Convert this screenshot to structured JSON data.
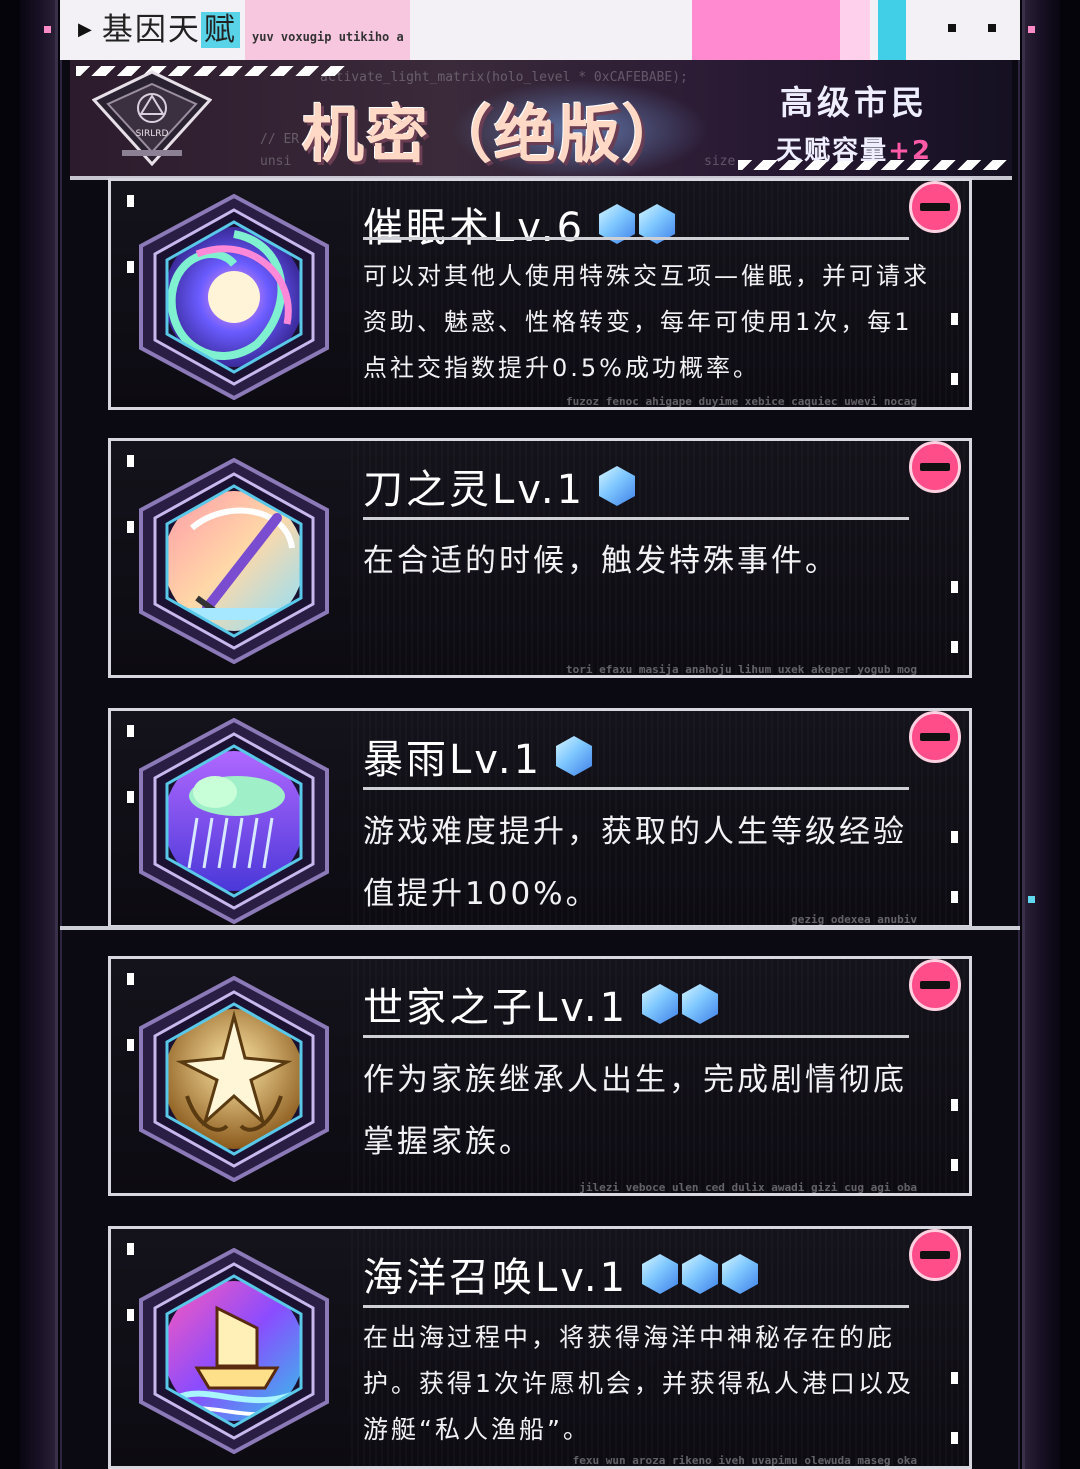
{
  "tab": {
    "title": "基因天赋",
    "subtitle": "yuv voxugip utikiho a"
  },
  "banner": {
    "badge_text": "SIRLRD",
    "title": "机密（绝版）",
    "rank_title": "高级市民",
    "rank_capacity_label": "天赋容量",
    "rank_capacity_bonus": "+2",
    "code_line_1": "activate_light_matrix(holo_level * 0xCAFEBABE);",
    "code_line_2": "// ER",
    "code_line_3": "unsi",
    "code_line_4": "size"
  },
  "colors": {
    "accent_pink": "#ff4d8a",
    "gem_blue": "#7fc8ff",
    "title_peach": "#ffd9c6"
  },
  "talents": [
    {
      "name": "催眠术Lv.6",
      "gems": 2,
      "icon": "hypnosis-vortex-icon",
      "description": "可以对其他人使用特殊交互项—催眠，并可请求资助、魅惑、性格转变，每年可使用1次，每1点社交指数提升0.5%成功概率。",
      "footer": "fuzoz fenoc ahigape duyime xebice caquiec uwevi nocag"
    },
    {
      "name": "刀之灵Lv.1",
      "gems": 1,
      "icon": "spirit-blade-icon",
      "description": "在合适的时候，触发特殊事件。",
      "footer": "tori efaxu masija anahoju lihum uxek akeper yogub mog"
    },
    {
      "name": "暴雨Lv.1",
      "gems": 1,
      "icon": "storm-cloud-icon",
      "description": "游戏难度提升，获取的人生等级经验值提升100%。",
      "footer": "gezig odexea anubiv"
    },
    {
      "name": "世家之子Lv.1",
      "gems": 2,
      "icon": "family-crest-icon",
      "description": "作为家族继承人出生，完成剧情彻底掌握家族。",
      "footer": "jilezi veboce ulen ced dulix awadi gizi cug agi oba"
    },
    {
      "name": "海洋召唤Lv.1",
      "gems": 3,
      "icon": "ocean-ship-icon",
      "description": "在出海过程中，将获得海洋中神秘存在的庇护。获得1次许愿机会，并获得私人港口以及游艇“私人渔船”。",
      "footer": "fexu wun aroza rikeno iveh uvapimu olewuda maseg oka"
    }
  ]
}
